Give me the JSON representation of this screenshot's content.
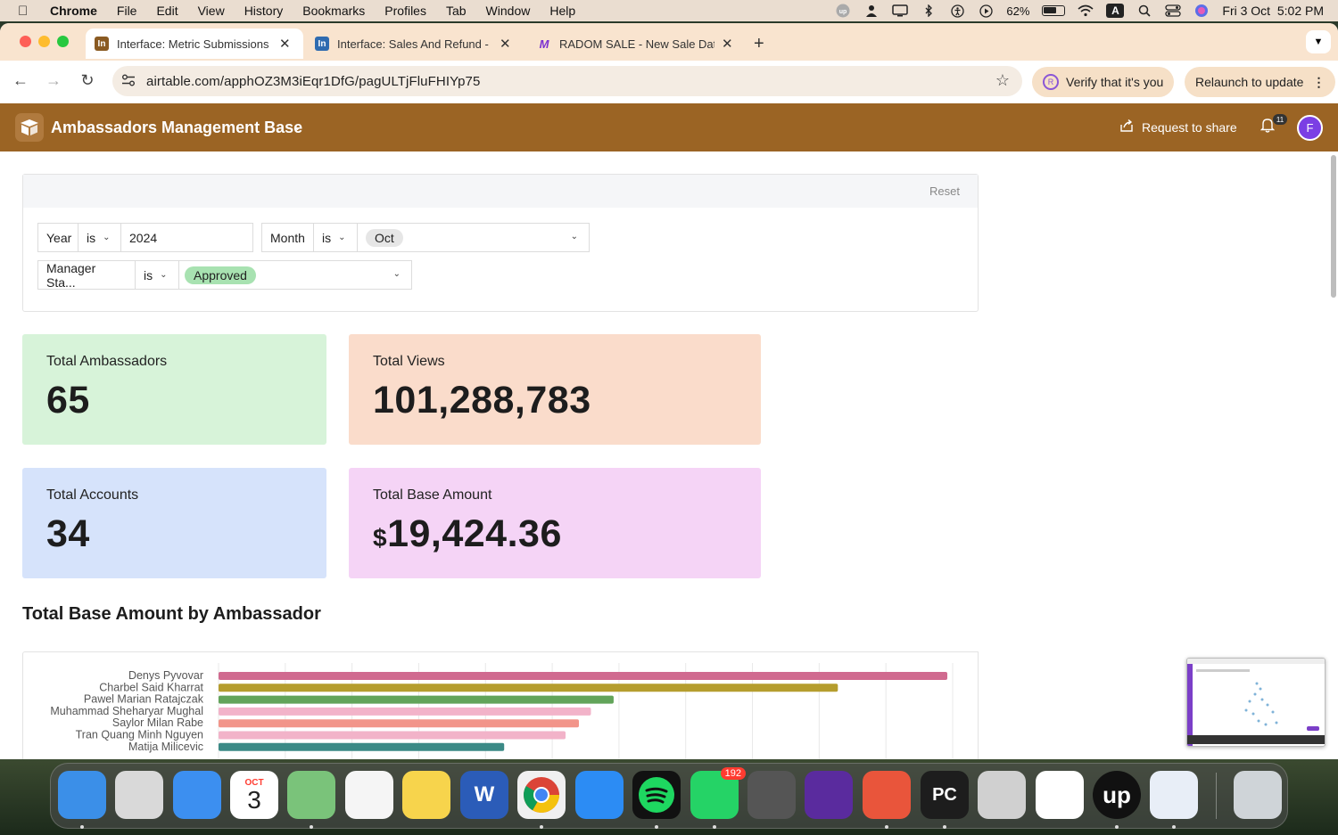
{
  "menubar": {
    "app": "Chrome",
    "items": [
      "File",
      "Edit",
      "View",
      "History",
      "Bookmarks",
      "Profiles",
      "Tab",
      "Window",
      "Help"
    ],
    "battery": "62%",
    "input_source": "A",
    "datetime": "Fri 3 Oct  5:02 PM"
  },
  "tabs": [
    {
      "label": "Interface: Metric Submissions",
      "favicon": "In",
      "color": "#8a5a22",
      "active": true
    },
    {
      "label": "Interface: Sales And Refund -",
      "favicon": "In",
      "color": "#2f6bb0",
      "active": false
    },
    {
      "label": "RADOM SALE - New Sale Dat",
      "favicon": "M",
      "color": "#7b2fd0",
      "active": false
    }
  ],
  "address": {
    "url": "airtable.com/apphOZ3M3iEqr1DfG/pagULTjFluFHIYp75",
    "verify_label": "Verify that it's you",
    "verify_avatar": "R",
    "relaunch_label": "Relaunch to update"
  },
  "header": {
    "title": "Ambassadors Management Base",
    "share_label": "Request to share",
    "notifications": "11",
    "user_initial": "F"
  },
  "filters": {
    "reset_label": "Reset",
    "rows": [
      {
        "field": "Year",
        "op": "is",
        "value": "2024"
      },
      {
        "field": "Month",
        "op": "is",
        "value": "Oct"
      },
      {
        "field": "Manager Sta...",
        "op": "is",
        "value": "Approved"
      }
    ]
  },
  "cards": [
    {
      "label": "Total Ambassadors",
      "value": "65",
      "color": "#d7f3d9"
    },
    {
      "label": "Total Views",
      "value": "101,288,783",
      "color": "#fadccb"
    },
    {
      "label": "Total Accounts",
      "value": "34",
      "color": "#d6e3fb"
    },
    {
      "label": "Total Base Amount",
      "currency": "$",
      "value": "19,424.36",
      "color": "#f5d4f6"
    }
  ],
  "chart_section_title": "Total Base Amount by Ambassador",
  "chart_data": {
    "type": "bar",
    "orientation": "horizontal",
    "categories": [
      "Denys Pyvovar",
      "Charbel Said Kharrat",
      "Pawel Marian Ratajczak",
      "Muhammad Sheharyar Mughal",
      "Saylor Milan Rabe",
      "Tran Quang Minh Nguyen",
      "Matija Milicevic"
    ],
    "values": [
      2730,
      2320,
      1480,
      1395,
      1350,
      1300,
      1070
    ],
    "colors": [
      "#d06a8f",
      "#b59d2e",
      "#62a45a",
      "#f2b3c9",
      "#f2958a",
      "#f2b3c9",
      "#3b8a86"
    ],
    "xlim": [
      0,
      2750
    ],
    "grid": true
  },
  "dock": [
    {
      "name": "finder-icon",
      "label": "",
      "color": "#3b8fe8"
    },
    {
      "name": "launchpad-icon",
      "label": "",
      "color": "#d9d9d9"
    },
    {
      "name": "mail-icon",
      "label": "",
      "color": "#3c8ff0"
    },
    {
      "name": "calendar-icon",
      "label": "3",
      "month": "OCT",
      "color": "#ffffff"
    },
    {
      "name": "maps-icon",
      "label": "",
      "color": "#7ac37a"
    },
    {
      "name": "reminders-icon",
      "label": "",
      "color": "#f5f5f5"
    },
    {
      "name": "notes-icon",
      "label": "",
      "color": "#f7d44c"
    },
    {
      "name": "word-icon",
      "label": "W",
      "color": "#2b5cb8"
    },
    {
      "name": "chrome-icon",
      "label": "",
      "color": "#f0f0f0"
    },
    {
      "name": "app-store-icon",
      "label": "",
      "color": "#2c8cf4"
    },
    {
      "name": "spotify-icon",
      "label": "",
      "color": "#111111"
    },
    {
      "name": "whatsapp-icon",
      "label": "",
      "color": "#25d366",
      "badge": "192"
    },
    {
      "name": "calculator-icon",
      "label": "",
      "color": "#555555"
    },
    {
      "name": "firefox-icon",
      "label": "",
      "color": "#5a2b9e"
    },
    {
      "name": "ticktick-icon",
      "label": "",
      "color": "#e9553b"
    },
    {
      "name": "pycharm-icon",
      "label": "PC",
      "color": "#1d1d1d"
    },
    {
      "name": "iphone-mirroring-icon",
      "label": "",
      "color": "#d0d0d0"
    },
    {
      "name": "slack-icon",
      "label": "",
      "color": "#ffffff"
    },
    {
      "name": "upwork-icon",
      "label": "up",
      "color": "#111111"
    },
    {
      "name": "mail-alt-icon",
      "label": "",
      "color": "#e8eef7"
    },
    {
      "name": "trash-icon",
      "label": "",
      "color": "#cfd4d8"
    }
  ]
}
